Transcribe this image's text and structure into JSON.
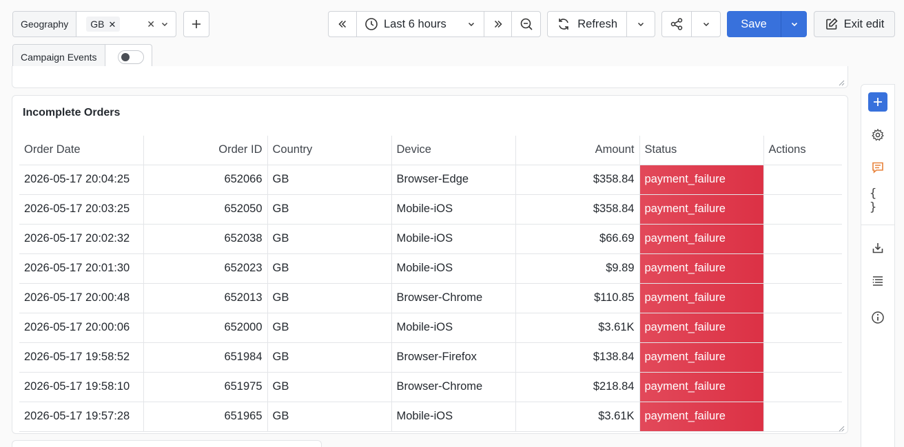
{
  "filters": {
    "geography": {
      "label": "Geography",
      "chip": "GB"
    },
    "campaign": {
      "label": "Campaign Events"
    }
  },
  "toolbar": {
    "time_range": "Last 6 hours",
    "refresh_label": "Refresh",
    "save_label": "Save",
    "exit_label": "Exit edit"
  },
  "panel": {
    "title": "Incomplete Orders",
    "columns": [
      "Order Date",
      "Order ID",
      "Country",
      "Device",
      "Amount",
      "Status",
      "Actions"
    ],
    "rows": [
      {
        "date": "2026-05-17 20:04:25",
        "id": "652066",
        "country": "GB",
        "device": "Browser-Edge",
        "amount": "$358.84",
        "status": "payment_failure"
      },
      {
        "date": "2026-05-17 20:03:25",
        "id": "652050",
        "country": "GB",
        "device": "Mobile-iOS",
        "amount": "$358.84",
        "status": "payment_failure"
      },
      {
        "date": "2026-05-17 20:02:32",
        "id": "652038",
        "country": "GB",
        "device": "Mobile-iOS",
        "amount": "$66.69",
        "status": "payment_failure"
      },
      {
        "date": "2026-05-17 20:01:30",
        "id": "652023",
        "country": "GB",
        "device": "Mobile-iOS",
        "amount": "$9.89",
        "status": "payment_failure"
      },
      {
        "date": "2026-05-17 20:00:48",
        "id": "652013",
        "country": "GB",
        "device": "Browser-Chrome",
        "amount": "$110.85",
        "status": "payment_failure"
      },
      {
        "date": "2026-05-17 20:00:06",
        "id": "652000",
        "country": "GB",
        "device": "Mobile-iOS",
        "amount": "$3.61K",
        "status": "payment_failure"
      },
      {
        "date": "2026-05-17 19:58:52",
        "id": "651984",
        "country": "GB",
        "device": "Browser-Firefox",
        "amount": "$138.84",
        "status": "payment_failure"
      },
      {
        "date": "2026-05-17 19:58:10",
        "id": "651975",
        "country": "GB",
        "device": "Browser-Chrome",
        "amount": "$218.84",
        "status": "payment_failure"
      },
      {
        "date": "2026-05-17 19:57:28",
        "id": "651965",
        "country": "GB",
        "device": "Mobile-iOS",
        "amount": "$3.61K",
        "status": "payment_failure"
      }
    ]
  },
  "sidebar": {
    "icons": [
      "add-panel-icon",
      "settings-icon",
      "comment-icon",
      "json-icon",
      "download-icon",
      "outline-icon",
      "info-icon"
    ]
  },
  "colors": {
    "primary": "#3871dc",
    "status_failure": "#dc3145",
    "comment_accent": "#e8823a"
  }
}
